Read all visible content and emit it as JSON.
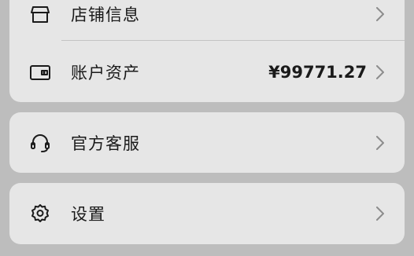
{
  "menu": {
    "store_info": {
      "label": "店铺信息",
      "icon": "store-icon"
    },
    "account_assets": {
      "label": "账户资产",
      "value": "¥99771.27",
      "icon": "wallet-icon"
    },
    "customer_service": {
      "label": "官方客服",
      "icon": "headset-icon"
    },
    "settings": {
      "label": "设置",
      "icon": "gear-icon"
    }
  }
}
